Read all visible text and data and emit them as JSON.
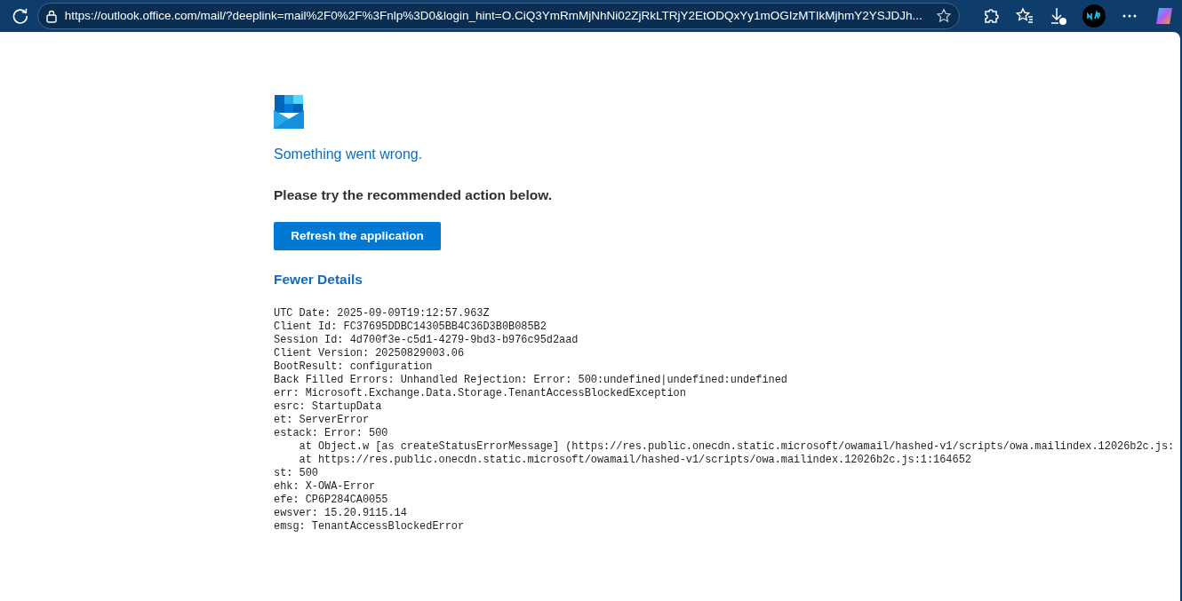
{
  "browser": {
    "url": "https://outlook.office.com/mail/?deeplink=mail%2F0%2F%3Fnlp%3D0&login_hint=O.CiQ3YmRmMjNhNi02ZjRkLTRjY2EtODQxYy1mOGIzMTIkMjhmY2YSJDJh..."
  },
  "error": {
    "title": "Something went wrong.",
    "message": "Please try the recommended action below.",
    "button": "Refresh the application",
    "details_toggle": "Fewer Details",
    "details": [
      "UTC Date: 2025-09-09T19:12:57.963Z",
      "Client Id: FC37695DDBC14305BB4C36D3B0B085B2",
      "Session Id: 4d700f3e-c5d1-4279-9bd3-b976c95d2aad",
      "Client Version: 20250829003.06",
      "BootResult: configuration",
      "Back Filled Errors: Unhandled Rejection: Error: 500:undefined|undefined:undefined",
      "err: Microsoft.Exchange.Data.Storage.TenantAccessBlockedException",
      "esrc: StartupData",
      "et: ServerError",
      "estack: Error: 500",
      "    at Object.w [as createStatusErrorMessage] (https://res.public.onecdn.static.microsoft/owamail/hashed-v1/scripts/owa.mailindex.12026b2c.js:",
      "    at https://res.public.onecdn.static.microsoft/owamail/hashed-v1/scripts/owa.mailindex.12026b2c.js:1:164652",
      "st: 500",
      "ehk: X-OWA-Error",
      "efe: CP6P284CA0055",
      "ewsver: 15.20.9115.14",
      "emsg: TenantAccessBlockedError"
    ]
  }
}
